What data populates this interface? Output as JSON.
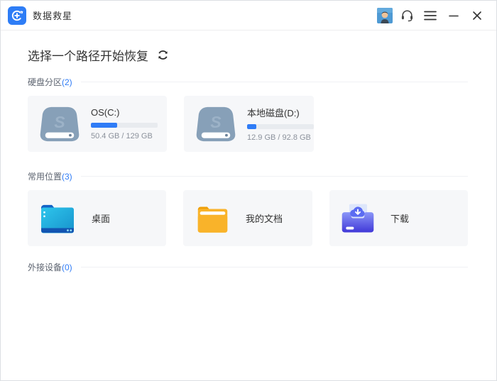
{
  "window": {
    "title": "数据救星"
  },
  "titlebar": {
    "icons": [
      "user-avatar",
      "headset",
      "menu",
      "minimize",
      "close"
    ]
  },
  "header": {
    "title": "选择一个路径开始恢复",
    "refresh_icon": "refresh-arrows"
  },
  "sections": [
    {
      "label": "硬盘分区",
      "count": "(2)"
    },
    {
      "label": "常用位置",
      "count": "(3)"
    },
    {
      "label": "外接设备",
      "count": "(0)"
    }
  ],
  "drives": [
    {
      "name": "OS(C:)",
      "usage": "50.4 GB / 129 GB",
      "percent": 39,
      "icon": "hard-drive-icon"
    },
    {
      "name": "本地磁盘(D:)",
      "usage": "12.9 GB / 92.8 GB",
      "percent": 14,
      "icon": "hard-drive-icon"
    }
  ],
  "locations": [
    {
      "name": "桌面",
      "icon": "desktop-folder-icon"
    },
    {
      "name": "我的文档",
      "icon": "documents-folder-icon"
    },
    {
      "name": "下载",
      "icon": "downloads-tray-icon"
    }
  ],
  "colors": {
    "accent": "#2f7cf6",
    "card_bg": "#f6f7f9",
    "track": "#e8ebef",
    "drive_body": "#87a0b8",
    "desktop_folder": "#1fa9dc",
    "documents_folder": "#f9b32a",
    "downloads_tray": "#4f5ae8"
  }
}
